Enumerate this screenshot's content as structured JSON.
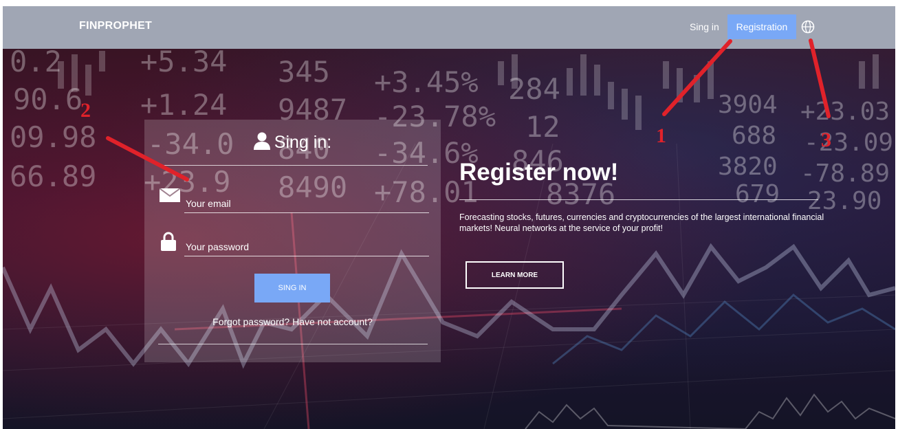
{
  "header": {
    "brand": "FINPROPHET",
    "nav_signin": "Sing in",
    "nav_registration": "Registration",
    "language_icon": "globe-icon"
  },
  "background": {
    "ticker_rows": [
      [
        "0.2",
        "+5.34",
        "345",
        "+3.45%",
        "284"
      ],
      [
        "90.6",
        "+1.24",
        "9487",
        "-23.78%",
        "12"
      ],
      [
        "09.98",
        "-34.0",
        "840",
        "-34.6%",
        "846"
      ],
      [
        "66.89",
        "+23.9",
        "8490",
        "+78.01",
        "8376"
      ]
    ],
    "ticker_right": [
      "3904",
      "+23.03",
      "688",
      "-23.09",
      "3820",
      "-78.89",
      "679",
      "23.90"
    ]
  },
  "login": {
    "title": "Sing in:",
    "user_icon": "user-icon",
    "email_icon": "envelope-icon",
    "email_placeholder": "Your email",
    "password_icon": "lock-icon",
    "password_placeholder": "Your password",
    "submit_label": "SING IN",
    "forgot_text": "Forgot password? Have not account?"
  },
  "register": {
    "title": "Register now!",
    "description": "Forecasting stocks, futures, currencies and cryptocurrencies of the largest international financial markets! Neural networks at the service of your profit!",
    "learn_more_label": "LEARN MORE"
  },
  "annotations": {
    "label_1": "1",
    "label_2": "2",
    "label_3": "3",
    "color": "#e0222a"
  },
  "colors": {
    "topbar": "#a0a6b4",
    "accent_button": "#79a8f6"
  }
}
